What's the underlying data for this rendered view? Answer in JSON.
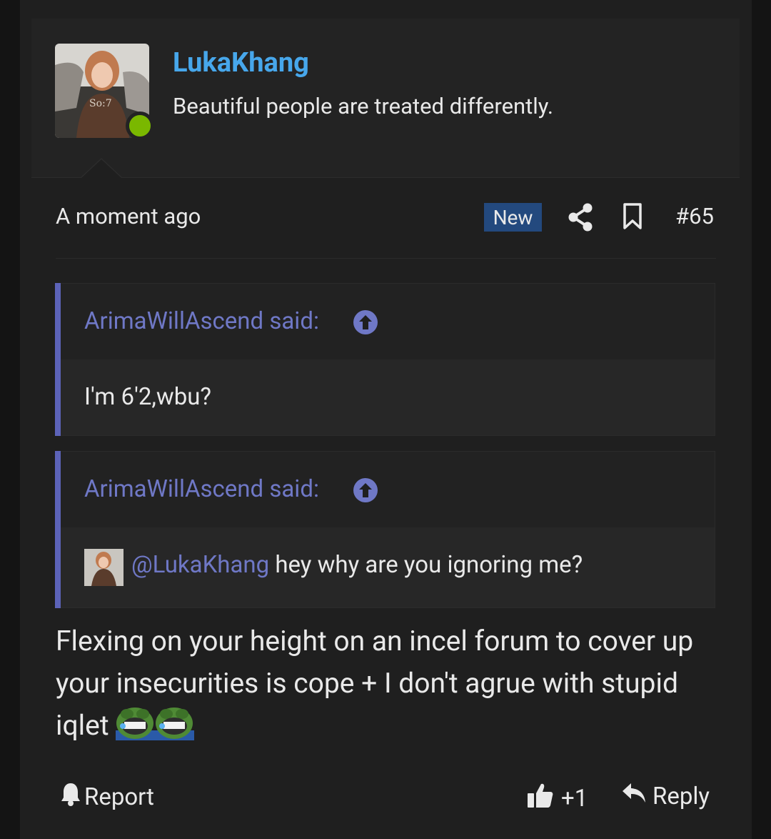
{
  "user": {
    "name": "LukaKhang",
    "title": "Beautiful people are treated differently.",
    "online": true
  },
  "meta": {
    "time": "A moment ago",
    "badge": "New",
    "post_number": "#65"
  },
  "quotes": [
    {
      "author": "ArimaWillAscend said:",
      "text": "I'm 6'2,wbu?"
    },
    {
      "author": "ArimaWillAscend said:",
      "mention": "@LukaKhang",
      "text": " hey why are you ignoring me?"
    }
  ],
  "message": "Flexing on your height on an incel forum to cover up your insecurities is cope + I don't agrue with stupid iqlet",
  "footer": {
    "report": "Report",
    "likes": "+1",
    "reply": "Reply"
  },
  "colors": {
    "username": "#47a7eb",
    "quote_accent": "#5c63b8",
    "online": "#7ab800",
    "badge": "#23497e"
  }
}
